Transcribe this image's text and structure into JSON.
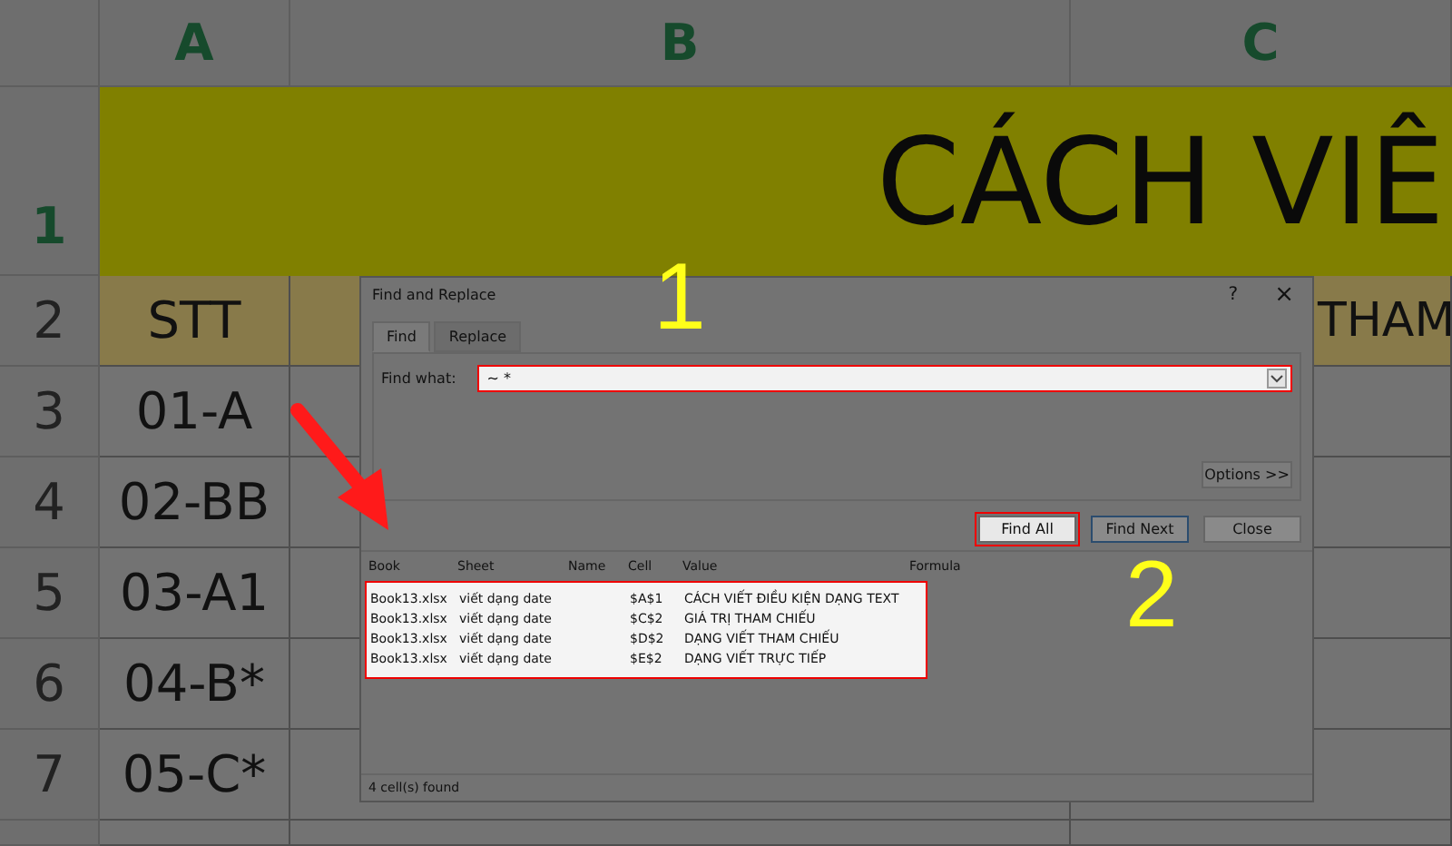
{
  "sheet": {
    "columns": [
      "A",
      "B",
      "C"
    ],
    "rows": [
      {
        "number": "1",
        "cells": [
          {
            "text": "",
            "kind": "title"
          },
          {
            "text": "",
            "kind": "title"
          },
          {
            "text": "CÁCH VIÊ",
            "kind": "title"
          }
        ]
      },
      {
        "number": "2",
        "cells": [
          {
            "text": "STT",
            "kind": "header"
          },
          {
            "text": "",
            "kind": "blank"
          },
          {
            "text": "THAM",
            "kind": "header"
          }
        ]
      },
      {
        "number": "3",
        "cells": [
          {
            "text": "01-A",
            "kind": "data"
          },
          {
            "text": "",
            "kind": "data"
          },
          {
            "text": "",
            "kind": "data"
          }
        ]
      },
      {
        "number": "4",
        "cells": [
          {
            "text": "02-BB",
            "kind": "data"
          },
          {
            "text": "",
            "kind": "data"
          },
          {
            "text": "",
            "kind": "data"
          }
        ]
      },
      {
        "number": "5",
        "cells": [
          {
            "text": "03-A1",
            "kind": "data"
          },
          {
            "text": "",
            "kind": "data"
          },
          {
            "text": "",
            "kind": "data"
          }
        ]
      },
      {
        "number": "6",
        "cells": [
          {
            "text": "04-B*",
            "kind": "data"
          },
          {
            "text": "",
            "kind": "data"
          },
          {
            "text": "",
            "kind": "data"
          }
        ]
      },
      {
        "number": "7",
        "cells": [
          {
            "text": "05-C*",
            "kind": "data"
          },
          {
            "text": "",
            "kind": "data"
          },
          {
            "text": "",
            "kind": "data"
          }
        ]
      }
    ]
  },
  "dialog": {
    "title": "Find and Replace",
    "help": "?",
    "close": "×",
    "tabs": [
      {
        "label": "Find",
        "selected": true
      },
      {
        "label": "Replace",
        "selected": false
      }
    ],
    "find_what": {
      "label": "Find what:",
      "value": "~ *",
      "highlighted": true
    },
    "options_button": "Options >>",
    "buttons": [
      {
        "label": "Find All",
        "highlighted": true
      },
      {
        "label": "Find Next",
        "highlighted": false
      },
      {
        "label": "Close",
        "highlighted": false
      }
    ],
    "results": {
      "highlighted": true,
      "columns": [
        "Book",
        "Sheet",
        "Name",
        "Cell",
        "Value",
        "Formula"
      ],
      "rows": [
        [
          "Book13.xlsx",
          "viết dạng date",
          "",
          "$A$1",
          "CÁCH VIẾT ĐIỀU KIỆN DẠNG TEXT",
          ""
        ],
        [
          "Book13.xlsx",
          "viết dạng date",
          "",
          "$C$2",
          "GIÁ TRỊ THAM CHIẾU",
          ""
        ],
        [
          "Book13.xlsx",
          "viết dạng date",
          "",
          "$D$2",
          "DẠNG VIẾT THAM CHIẾU",
          ""
        ],
        [
          "Book13.xlsx",
          "viết dạng date",
          "",
          "$E$2",
          "DẠNG VIẾT TRỰC TIẾP",
          ""
        ]
      ]
    },
    "status": "4 cell(s) found"
  },
  "annotations": [
    "1",
    "2"
  ]
}
